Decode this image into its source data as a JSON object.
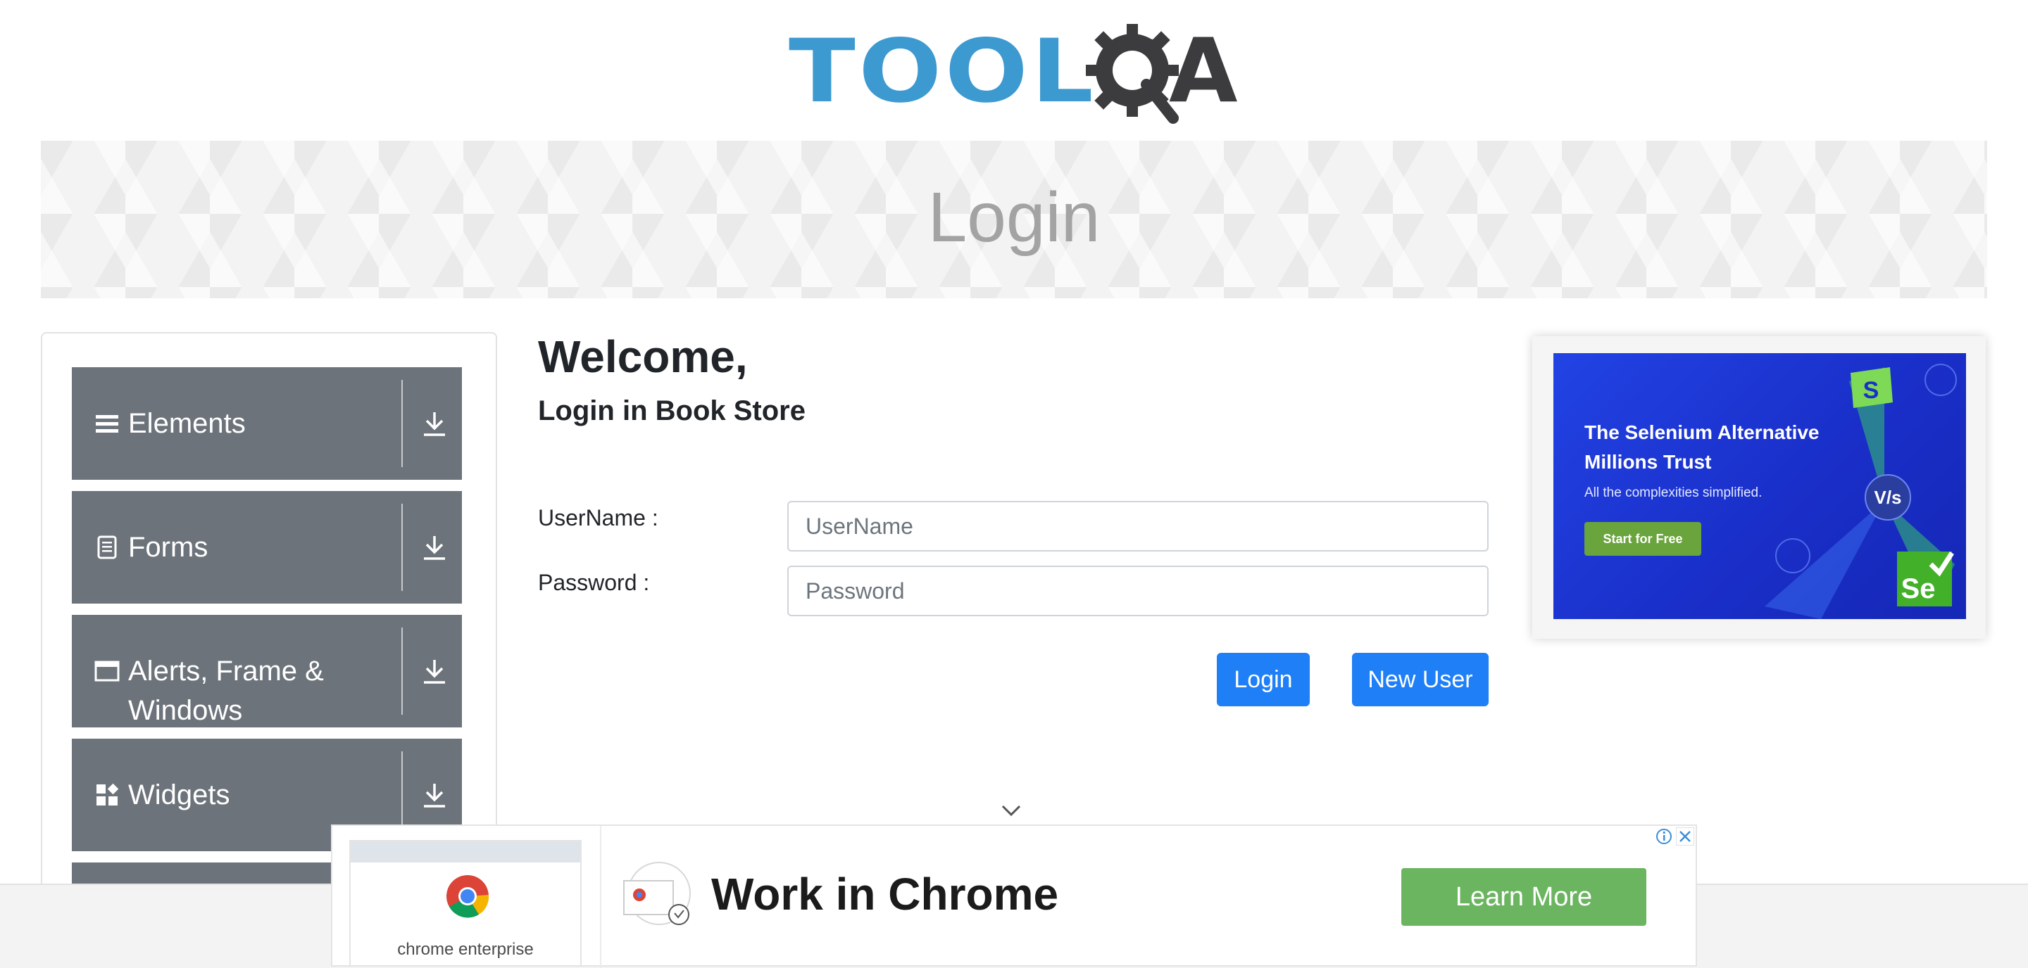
{
  "header": {
    "logo_text_tools": "TOOLS",
    "logo_text_a": "A"
  },
  "banner": {
    "title": "Login"
  },
  "sidebar": {
    "groups": [
      {
        "label": "Elements",
        "icon": "hamburger-icon"
      },
      {
        "label": "Forms",
        "icon": "document-icon"
      },
      {
        "label": "Alerts, Frame &",
        "label_line2": "Windows",
        "icon": "window-icon"
      },
      {
        "label": "Widgets",
        "icon": "widgets-icon"
      }
    ]
  },
  "main": {
    "welcome": "Welcome,",
    "subtitle": "Login in Book Store",
    "username_label": "UserName :",
    "username_placeholder": "UserName",
    "password_label": "Password :",
    "password_placeholder": "Password",
    "login_button": "Login",
    "new_user_button": "New User"
  },
  "right_ad": {
    "headline": "The Selenium Alternative Millions Trust",
    "subtext": "All the complexities simplified.",
    "cta": "Start for Free",
    "vs_text": "V/s",
    "s_badge": "S",
    "se_badge": "Se"
  },
  "bottom_ad": {
    "thumb_caption": "chrome enterprise",
    "title": "Work in Chrome",
    "cta": "Learn More"
  },
  "colors": {
    "primary_button": "#1e7ff7",
    "sidebar_group": "#6c737a",
    "logo_blue": "#3d9ad1",
    "ad_blue": "#1f3ad8",
    "learn_more_green": "#6bb560"
  }
}
